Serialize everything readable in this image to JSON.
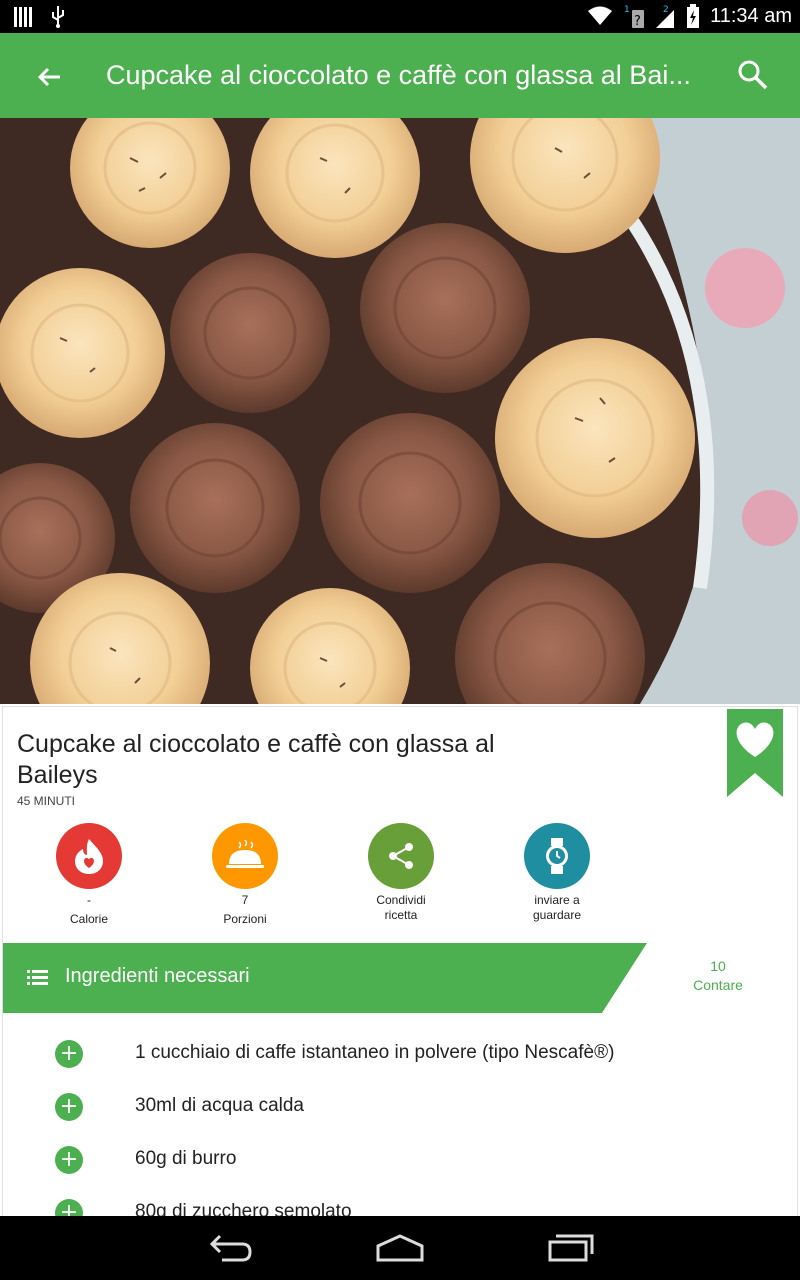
{
  "status": {
    "time": "11:34 am"
  },
  "appbar": {
    "title": "Cupcake al cioccolato e caffè con glassa al Bai..."
  },
  "recipe": {
    "title": "Cupcake al cioccolato e caffè con glassa al Baileys",
    "time": "45 MINUTI"
  },
  "actions": [
    {
      "value": "-",
      "label": "Calorie",
      "icon": "flame-heart-icon",
      "color": "#e53935"
    },
    {
      "value": "7",
      "label": "Porzioni",
      "icon": "serving-dish-icon",
      "color": "#ff9800"
    },
    {
      "label": "Condividi ricetta",
      "icon": "share-icon",
      "color": "#689f38"
    },
    {
      "label": "inviare a guardare",
      "icon": "watch-icon",
      "color": "#1e8ea0"
    }
  ],
  "ingredients": {
    "title": "Ingredienti necessari",
    "count": "10",
    "count_label": "Contare",
    "items": [
      "1 cucchiaio di caffe istantaneo in polvere (tipo Nescafè®)",
      "30ml di acqua calda",
      "60g di burro",
      "80g di zucchero semolato"
    ]
  },
  "colors": {
    "primary": "#4caf50",
    "statusbar": "#000000"
  }
}
